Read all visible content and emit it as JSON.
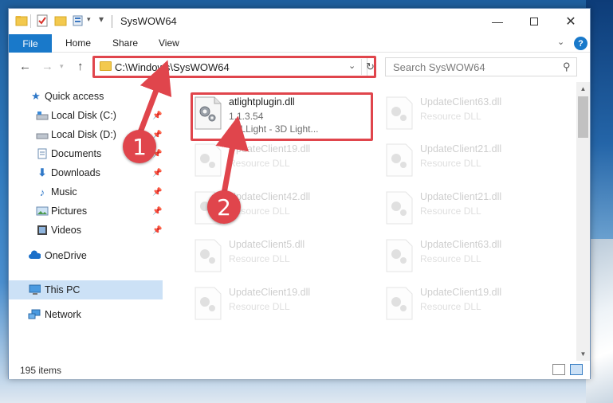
{
  "window": {
    "title": "SysWOW64"
  },
  "ribbon": {
    "file_tab": "File",
    "tabs": [
      "Home",
      "Share",
      "View"
    ],
    "help": "?"
  },
  "nav": {
    "address": "C:\\Windows\\SysWOW64",
    "search_placeholder": "Search SysWOW64"
  },
  "sidebar": {
    "items": [
      {
        "label": "Quick access",
        "icon": "star-icon"
      },
      {
        "label": "Local Disk (C:)",
        "icon": "drive-icon"
      },
      {
        "label": "Local Disk (D:)",
        "icon": "drive-icon"
      },
      {
        "label": "Documents",
        "icon": "documents-icon"
      },
      {
        "label": "Downloads",
        "icon": "download-icon"
      },
      {
        "label": "Music",
        "icon": "music-icon"
      },
      {
        "label": "Pictures",
        "icon": "pictures-icon"
      },
      {
        "label": "Videos",
        "icon": "videos-icon"
      },
      {
        "label": "OneDrive",
        "icon": "cloud-icon"
      },
      {
        "label": "This PC",
        "icon": "computer-icon"
      },
      {
        "label": "Network",
        "icon": "network-icon"
      }
    ]
  },
  "files": [
    {
      "name": "atlightplugin.dll",
      "line2": "1.1.3.54",
      "line3": "ATLLight - 3D Light...",
      "highlighted": true
    },
    {
      "name": "UpdateClient63.dll",
      "line2": "Resource DLL"
    },
    {
      "name": "UpdateClient19.dll",
      "line2": "Resource DLL"
    },
    {
      "name": "UpdateClient21.dll",
      "line2": "Resource DLL"
    },
    {
      "name": "UpdateClient42.dll",
      "line2": "Resource DLL"
    },
    {
      "name": "UpdateClient21.dll",
      "line2": "Resource DLL"
    },
    {
      "name": "UpdateClient5.dll",
      "line2": "Resource DLL"
    },
    {
      "name": "UpdateClient63.dll",
      "line2": "Resource DLL"
    },
    {
      "name": "UpdateClient19.dll",
      "line2": "Resource DLL"
    },
    {
      "name": "UpdateClient19.dll",
      "line2": "Resource DLL"
    }
  ],
  "status": {
    "item_count": "195 items"
  },
  "annotations": {
    "step1": "1",
    "step2": "2",
    "color": "#e0454c"
  }
}
